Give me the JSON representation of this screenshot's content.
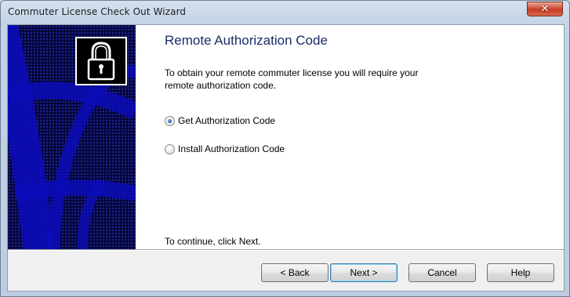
{
  "window": {
    "title": "Commuter License Check Out Wizard",
    "close_label": "✕"
  },
  "content": {
    "heading": "Remote Authorization Code",
    "description_line1": "To obtain your remote commuter license you will require your",
    "description_line2": "remote authorization code.",
    "options": [
      {
        "label": "Get Authorization Code",
        "selected": true
      },
      {
        "label": "Install  Authorization Code",
        "selected": false
      }
    ],
    "continue_text": "To continue, click Next."
  },
  "buttons": {
    "back": "< Back",
    "next": "Next >",
    "cancel": "Cancel",
    "help": "Help"
  },
  "icons": {
    "lock": "padlock-icon"
  },
  "colors": {
    "heading": "#1a2c6a",
    "side_panel_bg": "#06063a",
    "side_panel_pattern": "#1c1ca8",
    "close_button": "#c43a22",
    "default_button_border": "#3c7fb1"
  }
}
